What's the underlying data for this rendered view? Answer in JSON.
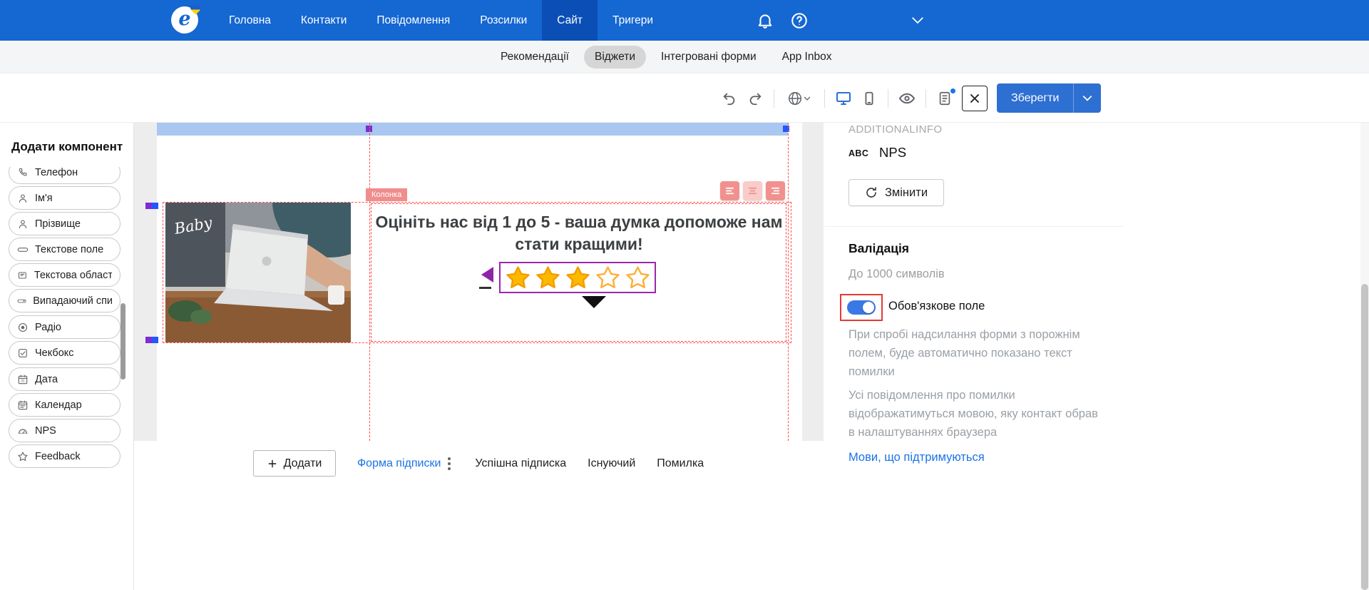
{
  "topnav": {
    "logo": "e",
    "items": [
      {
        "label": "Головна",
        "active": false
      },
      {
        "label": "Контакти",
        "active": false
      },
      {
        "label": "Повідомлення",
        "active": false
      },
      {
        "label": "Розсилки",
        "active": false
      },
      {
        "label": "Сайт",
        "active": true
      },
      {
        "label": "Тригери",
        "active": false
      }
    ]
  },
  "tabbar": {
    "items": [
      {
        "label": "Рекомендації",
        "active": false
      },
      {
        "label": "Віджети",
        "active": true
      },
      {
        "label": "Інтегровані форми",
        "active": false
      },
      {
        "label": "App Inbox",
        "active": false
      }
    ]
  },
  "toolbar": {
    "save_label": "Зберегти",
    "accent_color": "#2e6fd2"
  },
  "sidebar": {
    "title": "Додати компонент",
    "items": [
      {
        "label": "Телефон",
        "icon": "phone-icon"
      },
      {
        "label": "Ім'я",
        "icon": "person-icon"
      },
      {
        "label": "Прізвище",
        "icon": "person-icon"
      },
      {
        "label": "Текстове поле",
        "icon": "text-field-icon"
      },
      {
        "label": "Текстова область",
        "icon": "text-area-icon"
      },
      {
        "label": "Випадаючий список",
        "icon": "dropdown-icon"
      },
      {
        "label": "Радіо",
        "icon": "radio-icon"
      },
      {
        "label": "Чекбокс",
        "icon": "checkbox-icon"
      },
      {
        "label": "Дата",
        "icon": "date-icon"
      },
      {
        "label": "Календар",
        "icon": "calendar-icon"
      },
      {
        "label": "NPS",
        "icon": "gauge-icon"
      },
      {
        "label": "Feedback",
        "icon": "star-icon"
      }
    ]
  },
  "canvas": {
    "column_label": "Колонка",
    "heading": "Оцініть нас від 1 до 5 - ваша думка допоможе нам стати кращими!",
    "stars": {
      "filled": 3,
      "total": 5,
      "filled_color": "#fcb900",
      "border_color": "#9b27af"
    },
    "footer_tabs": [
      {
        "label": "Додати",
        "type": "button"
      },
      {
        "label": "Форма підписки",
        "active": true
      },
      {
        "label": "Успішна підписка",
        "active": false
      },
      {
        "label": "Існуючий",
        "active": false
      },
      {
        "label": "Помилка",
        "active": false
      }
    ]
  },
  "panel": {
    "section_label": "ADDITIONALINFO",
    "field_type_label": "ABC",
    "field_name": "NPS",
    "change_button": "Змінити",
    "validation_title": "Валідація",
    "max_length_note": "До 1000 символів",
    "required_label": "Обов'язкове поле",
    "required_enabled": true,
    "required_help": "При спробі надсилання форми з порожнім полем, буде автоматично показано текст помилки",
    "language_note": "Усі повідомлення про помилки відображатимуться мовою, яку контакт обрав в налаштуваннях браузера",
    "languages_link": "Мови, що підтримуються",
    "toggle_color": "#3b78e7",
    "highlight_color": "#e53935"
  }
}
